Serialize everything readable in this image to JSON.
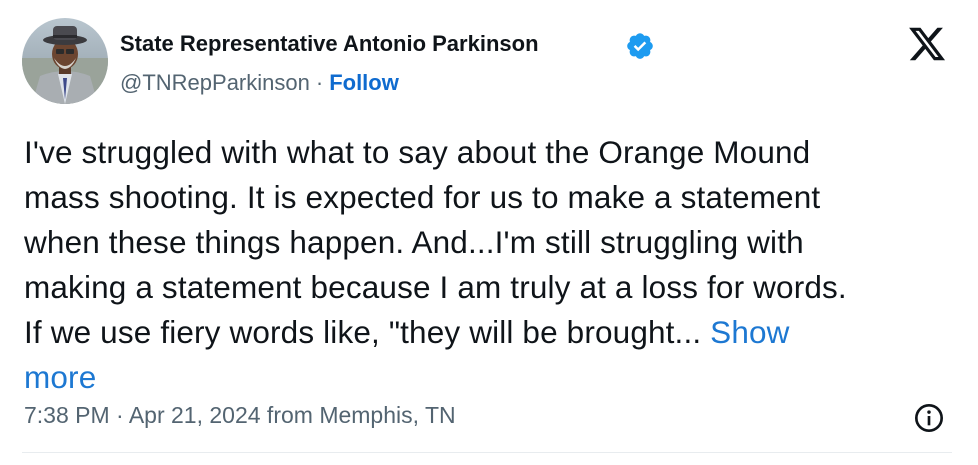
{
  "author": {
    "name": "State Representative Antonio Parkinson",
    "handle": "@TNRepParkinson",
    "separator": "·",
    "follow_label": "Follow",
    "verified": true
  },
  "tweet": {
    "lines": [
      "I've struggled with what to say about the  Orange Mound",
      "mass shooting. It is expected for us to make a statement",
      "when these things happen. And...I'm still struggling with",
      "making a statement because I am truly at a loss for words.",
      "If we use fiery words like, \"they will be brought... "
    ],
    "show_more_part1": "Show",
    "show_more_part2": "more"
  },
  "meta": {
    "timestamp": "7:38 PM · Apr 21, 2024 from Memphis, TN"
  },
  "icons": {
    "platform": "x-logo-icon",
    "verified": "verified-badge-icon",
    "info": "info-icon"
  },
  "colors": {
    "text": "#0f1419",
    "secondary": "#536471",
    "link": "#1d78d2",
    "verified": "#1d9bf0"
  }
}
